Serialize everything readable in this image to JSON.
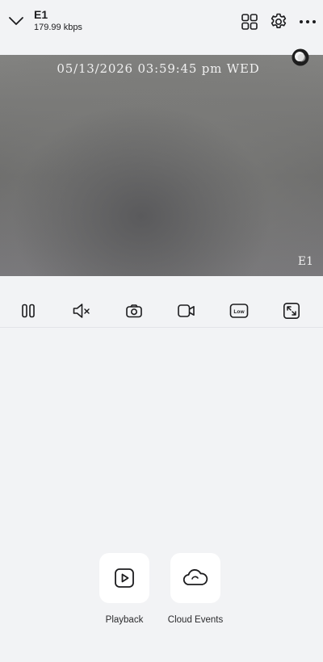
{
  "header": {
    "device_name": "E1",
    "bitrate": "179.99 kbps",
    "icons": [
      "chevron-down-icon",
      "multi-view-grid-icon",
      "gear-icon",
      "more-icon"
    ]
  },
  "video": {
    "timestamp": "05/13/2026 03:59:45 pm WED",
    "camera_label": "E1"
  },
  "controls": {
    "icons": [
      "pause-icon",
      "mute-icon",
      "snapshot-icon",
      "record-icon",
      "quality-low-icon",
      "fullscreen-icon"
    ],
    "quality_label": "Low"
  },
  "actions": [
    {
      "label": "Playback",
      "icon": "playback-icon"
    },
    {
      "label": "Cloud Events",
      "icon": "cloud-icon"
    }
  ],
  "colors": {
    "background": "#f2f3f5",
    "icon": "#1c1c1e",
    "card": "#ffffff"
  }
}
